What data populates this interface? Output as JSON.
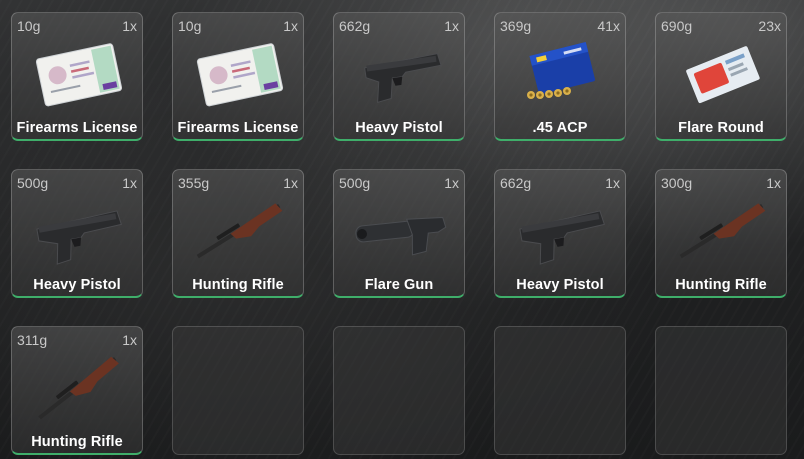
{
  "inventory": {
    "slots": [
      {
        "weight": "10g",
        "count": "1x",
        "label": "Firearms License",
        "icon": "license-card-icon"
      },
      {
        "weight": "10g",
        "count": "1x",
        "label": "Firearms License",
        "icon": "license-card-icon"
      },
      {
        "weight": "662g",
        "count": "1x",
        "label": "Heavy Pistol",
        "icon": "pistol-icon"
      },
      {
        "weight": "369g",
        "count": "41x",
        "label": ".45 ACP",
        "icon": "ammo-box-icon"
      },
      {
        "weight": "690g",
        "count": "23x",
        "label": "Flare Round",
        "icon": "flare-round-icon"
      },
      {
        "weight": "500g",
        "count": "1x",
        "label": "Heavy Pistol",
        "icon": "pistol-icon"
      },
      {
        "weight": "355g",
        "count": "1x",
        "label": "Hunting Rifle",
        "icon": "rifle-icon"
      },
      {
        "weight": "500g",
        "count": "1x",
        "label": "Flare Gun",
        "icon": "flare-gun-icon"
      },
      {
        "weight": "662g",
        "count": "1x",
        "label": "Heavy Pistol",
        "icon": "pistol-icon"
      },
      {
        "weight": "300g",
        "count": "1x",
        "label": "Hunting Rifle",
        "icon": "rifle-icon"
      },
      {
        "weight": "311g",
        "count": "1x",
        "label": "Hunting Rifle",
        "icon": "rifle-icon"
      }
    ],
    "empty_slots": 4
  },
  "colors": {
    "accent_bar": "#3fae6a",
    "slot_border": "#3a3a3a"
  }
}
